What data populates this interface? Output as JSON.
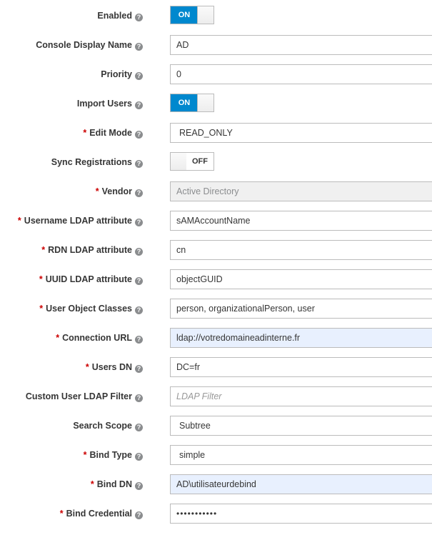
{
  "help_glyph": "?",
  "required_mark": "*",
  "fields": {
    "enabled": {
      "label": "Enabled",
      "state": "ON"
    },
    "console_display_name": {
      "label": "Console Display Name",
      "value": "AD"
    },
    "priority": {
      "label": "Priority",
      "value": "0"
    },
    "import_users": {
      "label": "Import Users",
      "state": "ON"
    },
    "edit_mode": {
      "label": "Edit Mode",
      "value": "READ_ONLY"
    },
    "sync_registrations": {
      "label": "Sync Registrations",
      "state": "OFF"
    },
    "vendor": {
      "label": "Vendor",
      "value": "Active Directory"
    },
    "username_ldap_attribute": {
      "label": "Username LDAP attribute",
      "value": "sAMAccountName"
    },
    "rdn_ldap_attribute": {
      "label": "RDN LDAP attribute",
      "value": "cn"
    },
    "uuid_ldap_attribute": {
      "label": "UUID LDAP attribute",
      "value": "objectGUID"
    },
    "user_object_classes": {
      "label": "User Object Classes",
      "value": "person, organizationalPerson, user"
    },
    "connection_url": {
      "label": "Connection URL",
      "value": "ldap://votredomaineadinterne.fr"
    },
    "users_dn": {
      "label": "Users DN",
      "value": "DC=fr"
    },
    "custom_user_ldap_filter": {
      "label": "Custom User LDAP Filter",
      "placeholder": "LDAP Filter"
    },
    "search_scope": {
      "label": "Search Scope",
      "value": "Subtree"
    },
    "bind_type": {
      "label": "Bind Type",
      "value": "simple"
    },
    "bind_dn": {
      "label": "Bind DN",
      "value": "AD\\utilisateurdebind"
    },
    "bind_credential": {
      "label": "Bind Credential",
      "value": "•••••••••••"
    }
  },
  "colors": {
    "toggle_on": "#0088ce",
    "required": "#cc0000",
    "autofill_bg": "#e8f0fe",
    "readonly_bg": "#f0f0f0"
  }
}
